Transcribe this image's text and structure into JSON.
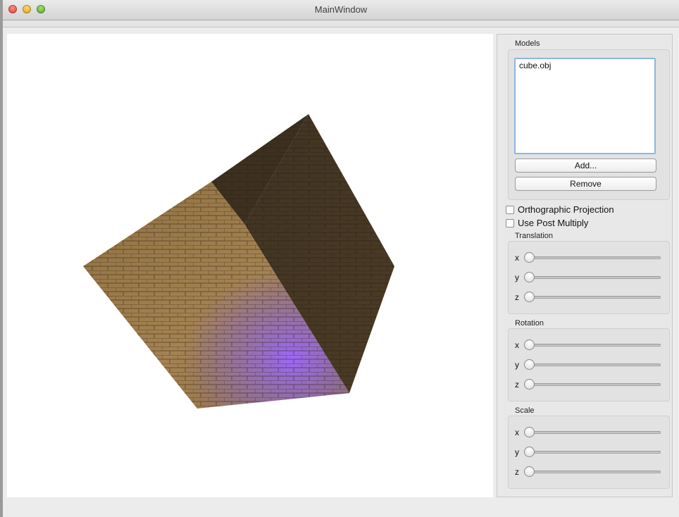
{
  "window": {
    "title": "MainWindow"
  },
  "models": {
    "group_label": "Models",
    "items": [
      "cube.obj"
    ],
    "add_label": "Add...",
    "remove_label": "Remove"
  },
  "options": {
    "orthographic_label": "Orthographic Projection",
    "orthographic_checked": false,
    "post_multiply_label": "Use Post Multiply",
    "post_multiply_checked": false
  },
  "translation": {
    "label": "Translation",
    "x_label": "x",
    "y_label": "y",
    "z_label": "z",
    "x": 0,
    "y": 0,
    "z": 0
  },
  "rotation": {
    "label": "Rotation",
    "x_label": "x",
    "y_label": "y",
    "z_label": "z",
    "x": 0,
    "y": 0,
    "z": 0
  },
  "scale": {
    "label": "Scale",
    "x_label": "x",
    "y_label": "y",
    "z_label": "z",
    "x": 0,
    "y": 0,
    "z": 0
  },
  "colors": {
    "accent": "#8fb5e4",
    "cube_left": "#9a7a4a",
    "cube_right": "#4a3a24",
    "cube_highlight": "#9b6cf0"
  }
}
